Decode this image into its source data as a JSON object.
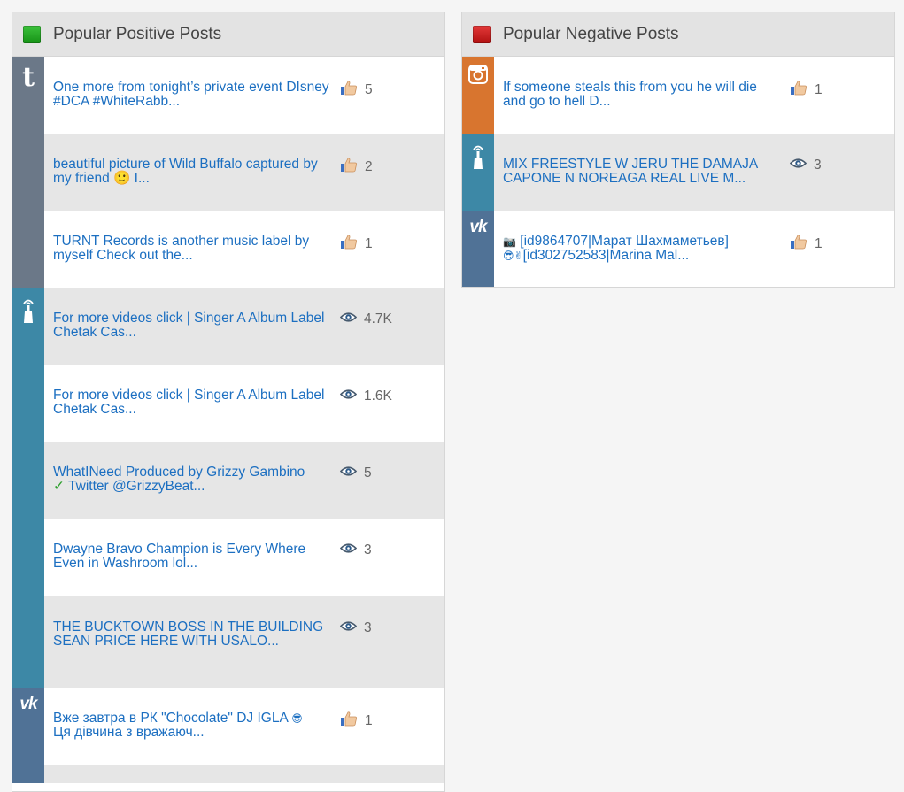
{
  "positive": {
    "title": "Popular Positive Posts",
    "header_color": "#1fa51f",
    "groups": [
      {
        "network": "tumblr",
        "network_color": "#6b7888",
        "rows": [
          {
            "text": "One more from tonight’s private event DIsney #DCA #WhiteRabb...",
            "metric": "likes",
            "value": "5"
          },
          {
            "text": "beautiful picture of Wild Buffalo captured by my friend 🙂 I...",
            "metric": "likes",
            "value": "2"
          },
          {
            "text": "TURNT Records is another music label by myself Check out the...",
            "metric": "likes",
            "value": "1"
          }
        ]
      },
      {
        "network": "periscope",
        "network_color": "#3d88a6",
        "rows": [
          {
            "text": "For more videos click | Singer A Album Label Chetak Cas...",
            "metric": "views",
            "value": "4.7K"
          },
          {
            "text": "For more videos click | Singer A Album Label Chetak Cas...",
            "metric": "views",
            "value": "1.6K"
          },
          {
            "text_a": "WhatINeed Produced by Grizzy Gambino",
            "text_b": "Twitter @GrizzyBeat...",
            "metric": "views",
            "value": "5"
          },
          {
            "text": "Dwayne Bravo Champion is Every Where Even in Washroom lol...",
            "metric": "views",
            "value": "3"
          },
          {
            "text": "THE BUCKTOWN BOSS IN THE BUILDING SEAN PRICE HERE WITH USALO...",
            "metric": "views",
            "value": "3"
          }
        ]
      },
      {
        "network": "vk",
        "network_color": "#507296",
        "rows": [
          {
            "text_a": "Вже завтра в РК \"Chocolate\" DJ IGLA",
            "text_b": "Ця дівчина з вражаюч...",
            "metric": "likes",
            "value": "1"
          }
        ]
      }
    ]
  },
  "negative": {
    "title": "Popular Negative Posts",
    "header_color": "#c81c1c",
    "groups": [
      {
        "network": "instagram",
        "network_color": "#d8752f",
        "rows": [
          {
            "text": "If someone steals this from you he will die and go to hell D...",
            "metric": "likes",
            "value": "1"
          }
        ]
      },
      {
        "network": "periscope",
        "network_color": "#3d88a6",
        "rows": [
          {
            "text": "MIX FREESTYLE W JERU THE DAMAJA CAPONE N NOREAGA REAL LIVE M...",
            "metric": "views",
            "value": "3"
          }
        ]
      },
      {
        "network": "vk",
        "network_color": "#507296",
        "rows": [
          {
            "text_a": "[id9864707|Марат Шахмаметьев]",
            "text_b": "[id302752583|Marina Mal...",
            "metric": "likes",
            "value": "1"
          }
        ]
      }
    ]
  },
  "icons": {
    "likes": "thumbs-up-icon",
    "views": "eye-icon",
    "tumblr": "tumblr-icon",
    "periscope": "periscope-icon",
    "vk": "vk-icon",
    "instagram": "instagram-icon"
  }
}
